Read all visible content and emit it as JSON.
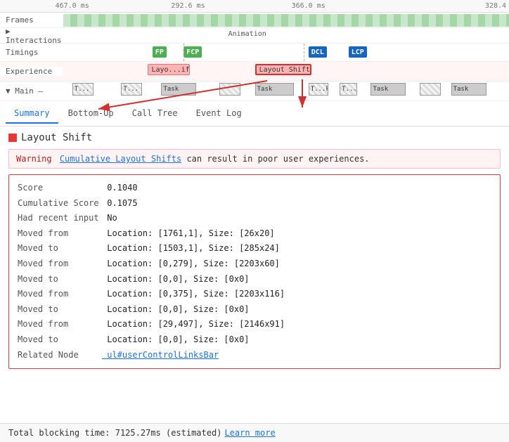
{
  "timeline": {
    "frames_label": "Frames",
    "interactions_label": "▶ Interactions",
    "timings_label": "Timings",
    "experience_label": "Experience",
    "main_label": "▼ Main —",
    "time_markers": [
      "467.0 ms",
      "292.6 ms",
      "366.0 ms",
      "328.4"
    ],
    "animation_label": "Animation",
    "timing_badges": [
      {
        "label": "FP",
        "class": "badge-fp"
      },
      {
        "label": "FCP",
        "class": "badge-fcp"
      },
      {
        "label": "DCL",
        "class": "badge-dcl"
      },
      {
        "label": "LCP",
        "class": "badge-lcp"
      }
    ],
    "exp_blocks": [
      {
        "label": "Layo...ift",
        "class": "exp-layout-shift-1"
      },
      {
        "label": "Layout Shift",
        "class": "exp-layout-shift-2"
      }
    ],
    "task_labels": [
      "T...",
      "T...",
      "Task",
      "Task",
      "T...k",
      "T...",
      "Task",
      "Task"
    ]
  },
  "tabs": [
    {
      "label": "Summary",
      "active": true
    },
    {
      "label": "Bottom-Up",
      "active": false
    },
    {
      "label": "Call Tree",
      "active": false
    },
    {
      "label": "Event Log",
      "active": false
    }
  ],
  "panel": {
    "title": "Layout Shift",
    "warning_prefix": "Warning",
    "warning_link": "Cumulative Layout Shifts",
    "warning_suffix": "can result in poor user experiences."
  },
  "details": [
    {
      "key": "Score",
      "value": "0.1040",
      "type": "text"
    },
    {
      "key": "Cumulative Score",
      "value": "0.1075",
      "type": "text"
    },
    {
      "key": "Had recent input",
      "value": "No",
      "type": "text"
    },
    {
      "key": "Moved from",
      "value": "Location: [1761,1], Size: [26x20]",
      "type": "text"
    },
    {
      "key": "Moved to",
      "value": "Location: [1503,1], Size: [285x24]",
      "type": "text"
    },
    {
      "key": "Moved from",
      "value": "Location: [0,279], Size: [2203x60]",
      "type": "text"
    },
    {
      "key": "Moved to",
      "value": "Location: [0,0], Size: [0x0]",
      "type": "text"
    },
    {
      "key": "Moved from",
      "value": "Location: [0,375], Size: [2203x116]",
      "type": "text"
    },
    {
      "key": "Moved to",
      "value": "Location: [0,0], Size: [0x0]",
      "type": "text"
    },
    {
      "key": "Moved from",
      "value": "Location: [29,497], Size: [2146x91]",
      "type": "text"
    },
    {
      "key": "Moved to",
      "value": "Location: [0,0], Size: [0x0]",
      "type": "text"
    },
    {
      "key": "Related Node",
      "value": "ul#userControlLinksBar",
      "type": "link"
    }
  ],
  "footer": {
    "text": "Total blocking time: 7125.27ms (estimated)",
    "link": "Learn more"
  }
}
